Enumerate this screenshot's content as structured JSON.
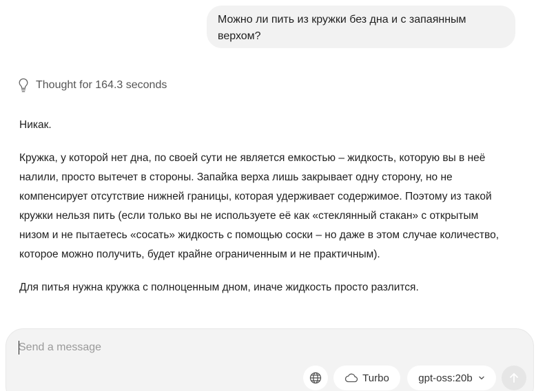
{
  "user_message": {
    "line1": "Можно ли пить из кружки без дна и с запаянным",
    "line2": "верхом?"
  },
  "thought": {
    "label": "Thought for 164.3 seconds",
    "icon": "lightbulb-icon"
  },
  "answer": {
    "paragraph1": "Никак.",
    "paragraph2_lines": [
      "Кружка, у которой нет дна, по своей сути не является емкостью – жидкость, которую вы в неё",
      "налили, просто вытечет в стороны. Запайка верха лишь закрывает одну сторону, но не",
      "компенсирует отсутствие нижней границы, которая удерживает содержимое. Поэтому из такой",
      "кружки нельзя пить (если только вы не используете её как «стеклянный стакан» с открытым",
      "низом и не пытаетесь «сосать» жидкость с помощью соски – но даже в этом случае количество,",
      "которое можно получить, будет крайне ограниченным и не практичным)."
    ],
    "paragraph3": "Для питья нужна кружка с полноценным дном, иначе жидкость просто разлится."
  },
  "composer": {
    "placeholder": "Send a message",
    "value": "",
    "web_search_icon": "globe-icon",
    "turbo_label": "Turbo",
    "turbo_icon": "cloud-icon",
    "model_label": "gpt-oss:20b",
    "model_icon": "chevron-down-icon",
    "send_icon": "arrow-up-icon"
  },
  "colors": {
    "bubble_bg": "#f2f2f2",
    "composer_bg": "#f3f3f3",
    "pill_bg": "#ffffff",
    "send_disabled_bg": "#e6e6e6",
    "muted_text": "#555555",
    "placeholder_text": "#9a9a9a"
  }
}
